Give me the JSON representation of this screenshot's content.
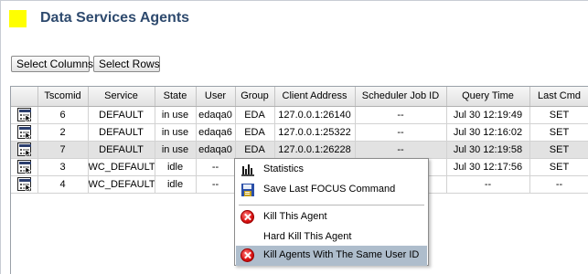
{
  "header": {
    "title": "Data Services Agents",
    "logo_color": "#ffff00"
  },
  "toolbar": {
    "select_columns": "Select Columns",
    "select_rows": "Select Rows"
  },
  "table": {
    "columns": [
      "Tscomid",
      "Service",
      "State",
      "User",
      "Group",
      "Client Address",
      "Scheduler Job ID",
      "Query Time",
      "Last Cmd"
    ],
    "rows": [
      [
        "6",
        "DEFAULT",
        "in use",
        "edaqa0",
        "EDA",
        "127.0.0.1:26140",
        "--",
        "Jul 30 12:19:49",
        "SET"
      ],
      [
        "2",
        "DEFAULT",
        "in use",
        "edaqa6",
        "EDA",
        "127.0.0.1:25322",
        "--",
        "Jul 30 12:16:02",
        "SET"
      ],
      [
        "7",
        "DEFAULT",
        "in use",
        "edaqa0",
        "EDA",
        "127.0.0.1:26228",
        "--",
        "Jul 30 12:19:58",
        "SET"
      ],
      [
        "3",
        "WC_DEFAULT",
        "idle",
        "--",
        "",
        "",
        "",
        "Jul 30 12:17:56",
        "SET"
      ],
      [
        "4",
        "WC_DEFAULT",
        "idle",
        "--",
        "",
        "",
        "",
        "--",
        "--"
      ]
    ],
    "selected_row": 2,
    "row_icon": "agent-detail-icon"
  },
  "context_menu": {
    "items": [
      {
        "label": "Statistics",
        "icon": "statistics-chart-icon"
      },
      {
        "label": "Save Last FOCUS Command",
        "icon": "save-disk-icon"
      },
      {
        "label": "Kill This Agent",
        "icon": "kill-stop-icon"
      },
      {
        "label": "Hard Kill This Agent",
        "icon": ""
      },
      {
        "label": "Kill Agents With The Same User ID",
        "icon": "kill-stop-icon"
      }
    ],
    "highlighted_index": 4,
    "highlight_color": "#aebdcc",
    "kill_icon_color": "#d81010"
  }
}
